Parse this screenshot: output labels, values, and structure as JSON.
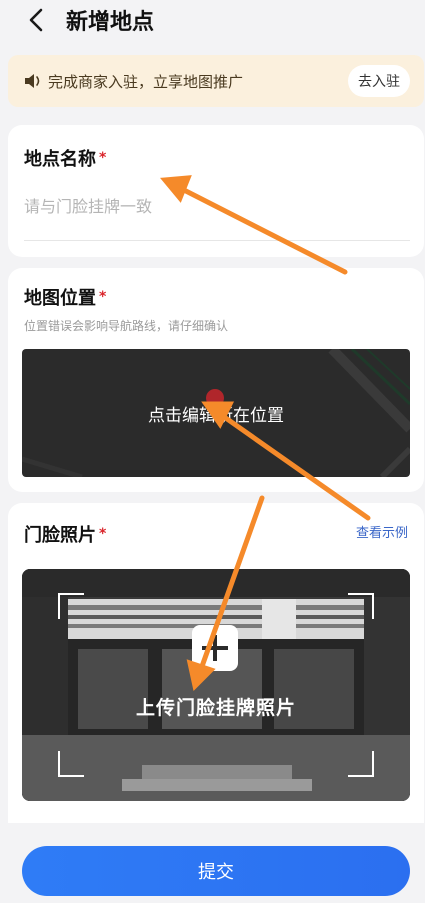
{
  "header": {
    "title": "新增地点"
  },
  "notice": {
    "text": "完成商家入驻，立享地图推广",
    "button": "去入驻"
  },
  "name_section": {
    "label": "地点名称",
    "required_mark": "*",
    "placeholder": "请与门脸挂牌一致",
    "value": ""
  },
  "map_section": {
    "label": "地图位置",
    "required_mark": "*",
    "hint": "位置错误会影响导航路线，请仔细确认",
    "map_text": "点击编辑所在位置"
  },
  "photo_section": {
    "label": "门脸照片",
    "required_mark": "*",
    "example_link": "查看示例",
    "upload_text": "上传门脸挂牌照片"
  },
  "submit": {
    "label": "提交"
  },
  "colors": {
    "accent": "#2f7cf6",
    "required": "#d9252b",
    "link": "#3a66c8",
    "notice_bg": "#fbf0dd",
    "annotation_arrow": "#f58a2a"
  }
}
